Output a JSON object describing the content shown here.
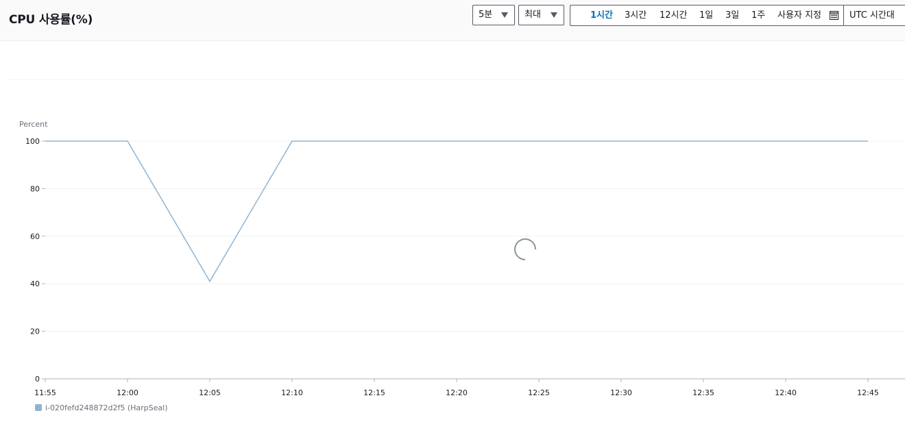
{
  "header": {
    "title": "CPU 사용률(%)",
    "period_select": "5분",
    "stat_select": "최대",
    "time_ranges": [
      {
        "label": "1시간",
        "active": true
      },
      {
        "label": "3시간",
        "active": false
      },
      {
        "label": "12시간",
        "active": false
      },
      {
        "label": "1일",
        "active": false
      },
      {
        "label": "3일",
        "active": false
      },
      {
        "label": "1주",
        "active": false
      },
      {
        "label": "사용자 지정",
        "active": false
      }
    ],
    "custom_icon": "calendar-icon",
    "timezone": "UTC 시간대"
  },
  "loading_icon": "spinner-icon",
  "chart_data": {
    "type": "line",
    "ylabel": "Percent",
    "ylim": [
      0,
      100
    ],
    "yticks": [
      0,
      20,
      40,
      60,
      80,
      100
    ],
    "xticks": [
      "11:55",
      "12:00",
      "12:05",
      "12:10",
      "12:15",
      "12:20",
      "12:25",
      "12:30",
      "12:35",
      "12:40",
      "12:45"
    ],
    "grid": true,
    "legend_position": "bottom-left",
    "series": [
      {
        "name": "i-020fefd248872d2f5 (HarpSeal)",
        "color": "#8eb4d2",
        "x": [
          "11:55",
          "12:00",
          "12:05",
          "12:10",
          "12:15",
          "12:20",
          "12:25",
          "12:30",
          "12:35",
          "12:40",
          "12:45"
        ],
        "y": [
          100,
          100,
          41,
          100,
          100,
          100,
          100,
          100,
          100,
          100,
          100
        ]
      }
    ]
  }
}
